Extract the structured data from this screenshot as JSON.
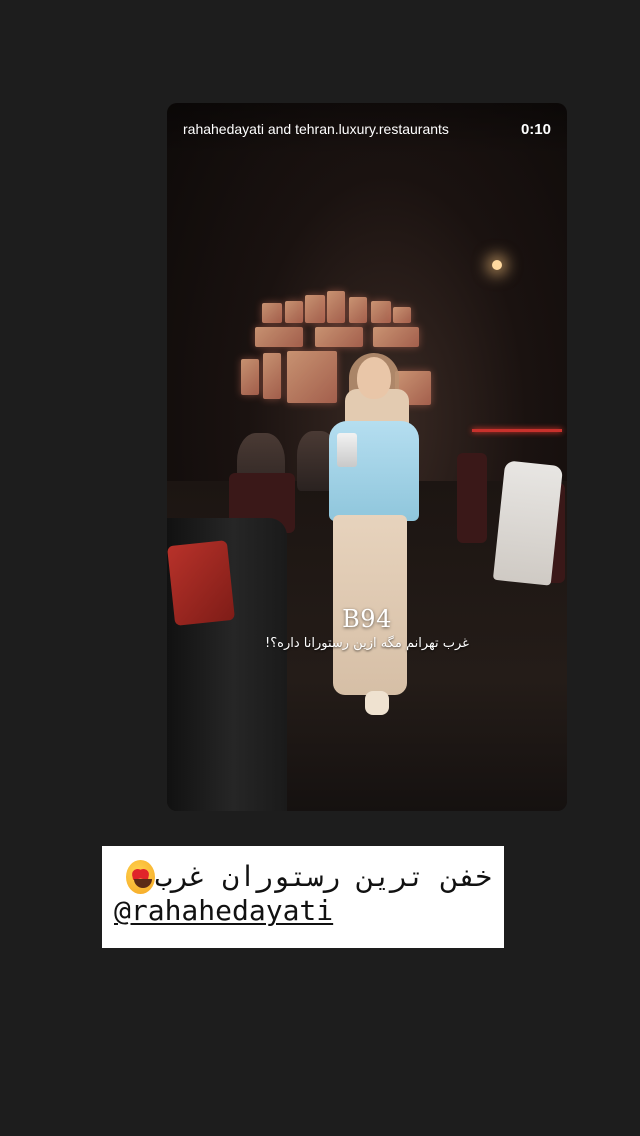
{
  "story": {
    "accounts": "rahahedayati and tehran.luxury.restaurants",
    "timer": "0:10",
    "overlay_title": "B94",
    "overlay_caption": "غرب تهرانم مگه ازین رستورانا داره؟!"
  },
  "sticker": {
    "line1_text": "خفن ترین رستوران غرب",
    "emoji": "heart-eyes-emoji",
    "mention": "@rahahedayati"
  }
}
